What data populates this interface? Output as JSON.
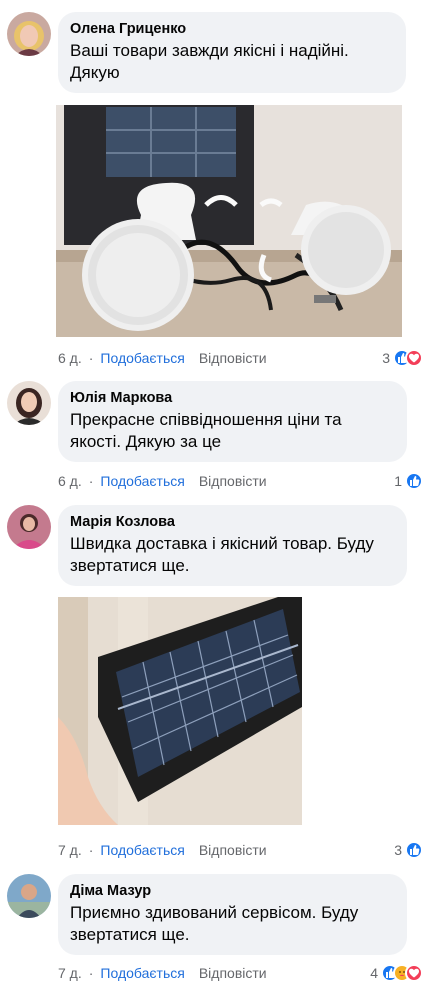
{
  "comments": [
    {
      "author": "Олена Гриценко",
      "text": "Ваші товари завжди якісні і надійні. Дякую",
      "age": "6 д.",
      "like_label": "Подобається",
      "reply_label": "Відповісти",
      "reaction_count": "3",
      "reactions": [
        "like-icon",
        "love-icon"
      ],
      "photo": "solar-lamp-kit-photo"
    },
    {
      "author": "Юлія Маркова",
      "text": "Прекрасне співвідношення ціни та якості. Дякую за це",
      "age": "6 д.",
      "like_label": "Подобається",
      "reply_label": "Відповісти",
      "reaction_count": "1",
      "reactions": [
        "like-icon"
      ]
    },
    {
      "author": "Марія Козлова",
      "text": "Швидка доставка і якісний товар. Буду звертатися ще.",
      "age": "7 д.",
      "like_label": "Подобається",
      "reply_label": "Відповісти",
      "reaction_count": "3",
      "reactions": [
        "like-icon"
      ],
      "photo": "solar-panel-photo"
    },
    {
      "author": "Діма Мазур",
      "text": "Приємно здивований сервісом. Буду звертатися ще.",
      "age": "7 д.",
      "like_label": "Подобається",
      "reply_label": "Відповісти",
      "reaction_count": "4",
      "reactions": [
        "like-icon",
        "care-icon",
        "love-icon"
      ]
    }
  ],
  "colors": {
    "bubble": "#f0f2f5",
    "link": "#216fdb",
    "meta": "#65676b",
    "like": "#1877f2",
    "love": "#f33e58"
  }
}
